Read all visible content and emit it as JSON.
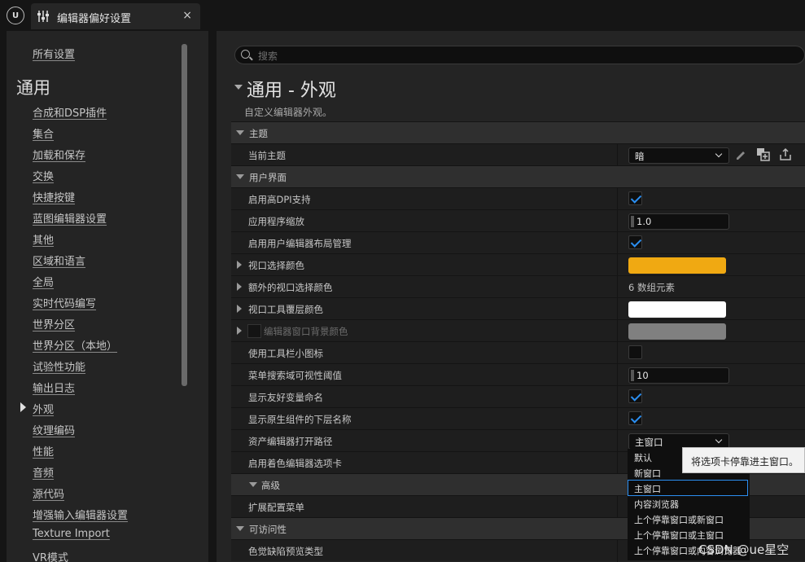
{
  "tab": {
    "title": "编辑器偏好设置",
    "close": "×"
  },
  "sidebar": {
    "all_settings": "所有设置",
    "heading": "通用",
    "items": [
      "合成和DSP插件",
      "集合",
      "加载和保存",
      "交换",
      "快捷按键",
      "蓝图编辑器设置",
      "其他",
      "区域和语言",
      "全局",
      "实时代码编写",
      "世界分区",
      "世界分区（本地）",
      "试验性功能",
      "输出日志",
      "外观",
      "纹理编码",
      "性能",
      "音频",
      "源代码",
      "增强输入编辑器设置",
      "Texture Import",
      "VR模式"
    ],
    "selected_index": 14
  },
  "search": {
    "placeholder": "搜索"
  },
  "section": {
    "title": "通用 - 外观",
    "subtitle": "自定义编辑器外观。"
  },
  "rows": [
    {
      "type": "cat",
      "label": "主题"
    },
    {
      "type": "prop",
      "label": "当前主题",
      "control": "combo",
      "value": "暗",
      "tools": true
    },
    {
      "type": "cat",
      "label": "用户界面"
    },
    {
      "type": "prop",
      "label": "启用高DPI支持",
      "control": "check",
      "checked": true
    },
    {
      "type": "prop",
      "label": "应用程序缩放",
      "control": "num",
      "value": "1.0"
    },
    {
      "type": "prop",
      "label": "启用用户编辑器布局管理",
      "control": "check",
      "checked": true
    },
    {
      "type": "prop",
      "label": "视口选择颜色",
      "control": "swatch",
      "color": "#f0a912",
      "expand": true
    },
    {
      "type": "prop",
      "label": "额外的视口选择颜色",
      "control": "text",
      "value": "6 数组元素",
      "expand": true
    },
    {
      "type": "prop",
      "label": "视口工具覆层颜色",
      "control": "swatch",
      "color": "#ffffff",
      "expand": true
    },
    {
      "type": "prop",
      "label": "编辑器窗口背景颜色",
      "control": "swatch",
      "color": "#808080",
      "expand": true,
      "disabled": true
    },
    {
      "type": "prop",
      "label": "使用工具栏小图标",
      "control": "check",
      "checked": false
    },
    {
      "type": "prop",
      "label": "菜单搜索域可视性阈值",
      "control": "num",
      "value": "10"
    },
    {
      "type": "prop",
      "label": "显示友好变量命名",
      "control": "check",
      "checked": true
    },
    {
      "type": "prop",
      "label": "显示原生组件的下层名称",
      "control": "check",
      "checked": true
    },
    {
      "type": "prop",
      "label": "资产编辑器打开路径",
      "control": "combo",
      "value": "主窗口"
    },
    {
      "type": "prop",
      "label": "启用着色编辑器选项卡",
      "control": "none"
    },
    {
      "type": "cat",
      "label": "高级",
      "indent": true
    },
    {
      "type": "prop",
      "label": "扩展配置菜单",
      "control": "none"
    },
    {
      "type": "cat",
      "label": "可访问性"
    },
    {
      "type": "prop",
      "label": "色觉缺陷预览类型",
      "control": "none"
    }
  ],
  "dropdown": {
    "options": [
      "默认",
      "新窗口",
      "主窗口",
      "内容浏览器",
      "上个停靠窗口或新窗口",
      "上个停靠窗口或主窗口",
      "上个停靠窗口或内容浏览器"
    ],
    "selected_index": 2
  },
  "tooltip": "将选项卡停靠进主窗口。",
  "watermark": "CSDN @ue星空",
  "colors": {
    "accent": "#2b8ef0",
    "viewport_selection": "#f0a912"
  }
}
